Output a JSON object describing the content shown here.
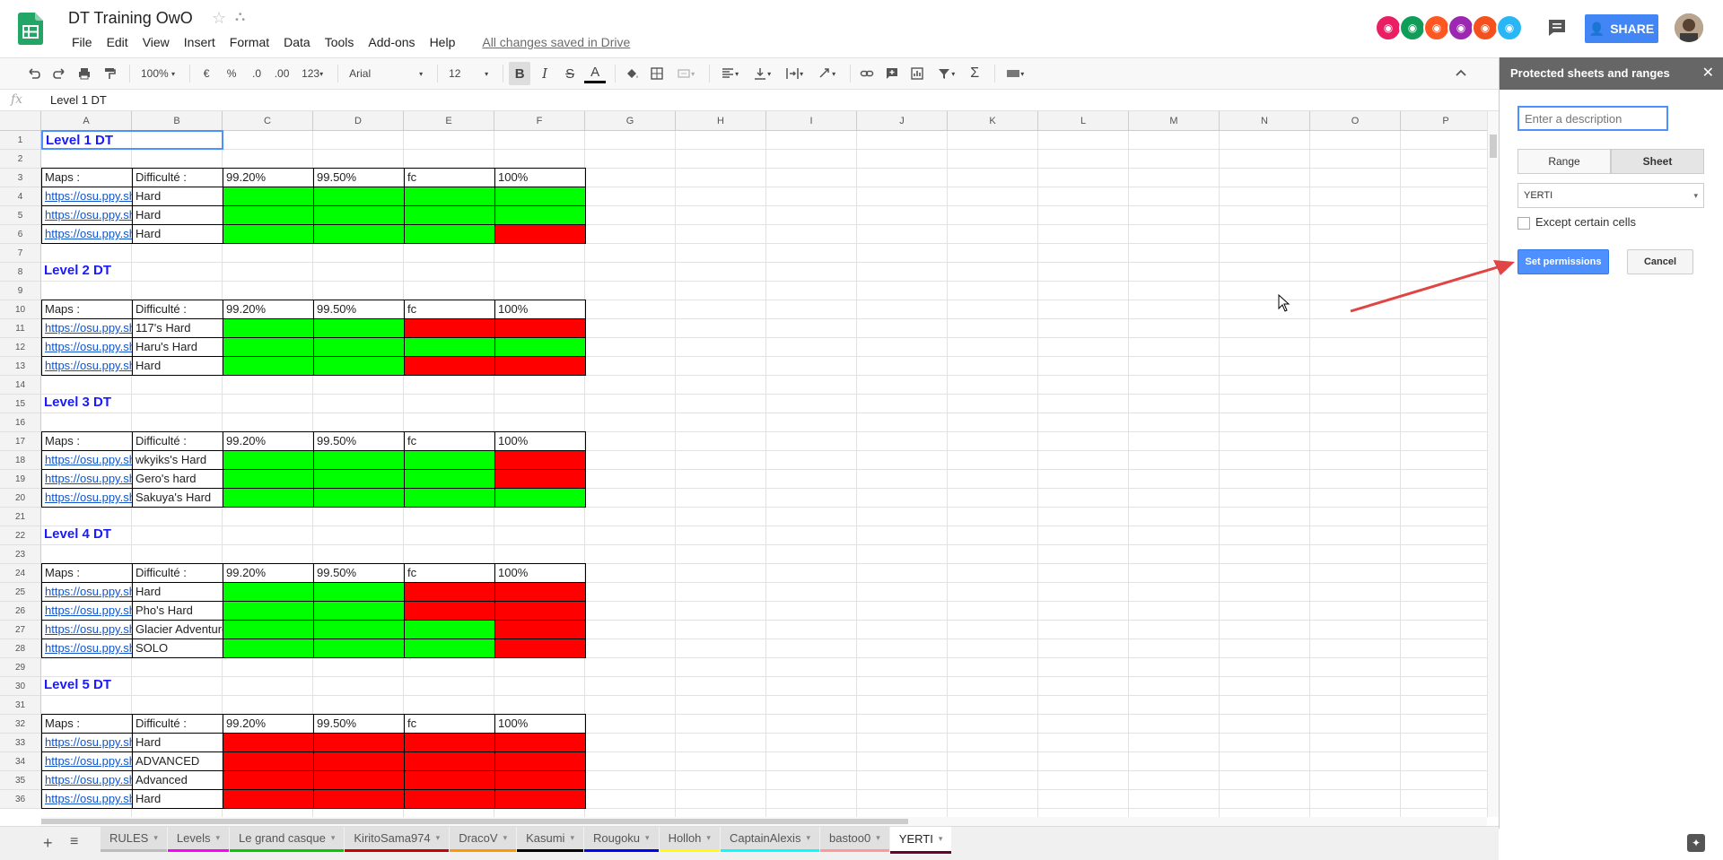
{
  "doc": {
    "title": "DT Training OwO",
    "saved": "All changes saved in Drive"
  },
  "menu": [
    "File",
    "Edit",
    "View",
    "Insert",
    "Format",
    "Data",
    "Tools",
    "Add-ons",
    "Help"
  ],
  "toolbar": {
    "zoom": "100%",
    "currency": "€",
    "percent": "%",
    "dec_less": ".0",
    "dec_more": ".00",
    "format": "123",
    "font": "Arial",
    "size": "12",
    "bold": "B",
    "italic": "I",
    "strike": "S",
    "underline_a": "A"
  },
  "share_label": "SHARE",
  "formula": {
    "icon": "fx",
    "value": "Level 1 DT"
  },
  "columns": [
    "A",
    "B",
    "C",
    "D",
    "E",
    "F",
    "G",
    "H",
    "I",
    "J",
    "K",
    "L",
    "M",
    "N",
    "O",
    "P"
  ],
  "rows": [
    "1",
    "2",
    "3",
    "4",
    "5",
    "6",
    "7",
    "8",
    "9",
    "10",
    "11",
    "12",
    "13",
    "14",
    "15",
    "16",
    "17",
    "18",
    "19",
    "20",
    "21",
    "22",
    "23",
    "24",
    "25",
    "26",
    "27",
    "28",
    "29",
    "30",
    "31",
    "32",
    "33",
    "34",
    "35",
    "36"
  ],
  "header_row": [
    "Maps :",
    "Difficulté :",
    "99.20%",
    "99.50%",
    "fc",
    "100%"
  ],
  "link_text": "https://osu.ppy.sh",
  "blocks": [
    {
      "title": "Level 1 DT",
      "rows": [
        [
          "Hard",
          "G",
          "G",
          "G",
          "G"
        ],
        [
          "Hard",
          "G",
          "G",
          "G",
          "G"
        ],
        [
          "Hard",
          "G",
          "G",
          "G",
          "R"
        ]
      ]
    },
    {
      "title": "Level 2 DT",
      "rows": [
        [
          "117's Hard",
          "G",
          "G",
          "R",
          "R"
        ],
        [
          "Haru's Hard",
          "G",
          "G",
          "G",
          "G"
        ],
        [
          "Hard",
          "G",
          "G",
          "R",
          "R"
        ]
      ]
    },
    {
      "title": "Level 3 DT",
      "rows": [
        [
          "wkyiks's Hard",
          "G",
          "G",
          "G",
          "R"
        ],
        [
          "Gero's hard",
          "G",
          "G",
          "G",
          "R"
        ],
        [
          "Sakuya's Hard",
          "G",
          "G",
          "G",
          "G"
        ]
      ]
    },
    {
      "title": "Level 4 DT",
      "rows": [
        [
          "Hard",
          "G",
          "G",
          "R",
          "R"
        ],
        [
          "Pho's Hard",
          "G",
          "G",
          "R",
          "R"
        ],
        [
          "Glacier Adventure",
          "G",
          "G",
          "G",
          "R"
        ],
        [
          "SOLO",
          "G",
          "G",
          "G",
          "R"
        ]
      ]
    },
    {
      "title": "Level 5 DT",
      "rows": [
        [
          "Hard",
          "R",
          "R",
          "R",
          "R"
        ],
        [
          "ADVANCED",
          "R",
          "R",
          "R",
          "R"
        ],
        [
          "Advanced",
          "R",
          "R",
          "R",
          "R"
        ],
        [
          "Hard",
          "R",
          "R",
          "R",
          "R"
        ]
      ]
    }
  ],
  "tabs": [
    {
      "label": "RULES",
      "color": "#bbbbbb"
    },
    {
      "label": "Levels",
      "color": "#ff00ff"
    },
    {
      "label": "Le grand casque",
      "color": "#00cc00"
    },
    {
      "label": "KiritoSama974",
      "color": "#cc0000"
    },
    {
      "label": "DracoV",
      "color": "#ff9900"
    },
    {
      "label": "Kasumi",
      "color": "#000000"
    },
    {
      "label": "Rougoku",
      "color": "#0000ff"
    },
    {
      "label": "Holloh",
      "color": "#ffff00"
    },
    {
      "label": "CaptainAlexis",
      "color": "#00ffff"
    },
    {
      "label": "bastoo0",
      "color": "#ff9999"
    },
    {
      "label": "YERTI",
      "color": "#660033"
    }
  ],
  "panel": {
    "title": "Protected sheets and ranges",
    "desc_placeholder": "Enter a description",
    "range": "Range",
    "sheet": "Sheet",
    "selected_sheet": "YERTI",
    "except": "Except certain cells",
    "set_permissions": "Set permissions",
    "cancel": "Cancel"
  },
  "colors": {
    "green": "#00ff00",
    "red": "#ff0000",
    "accent": "#4285f4",
    "arrow": "#e04444"
  }
}
